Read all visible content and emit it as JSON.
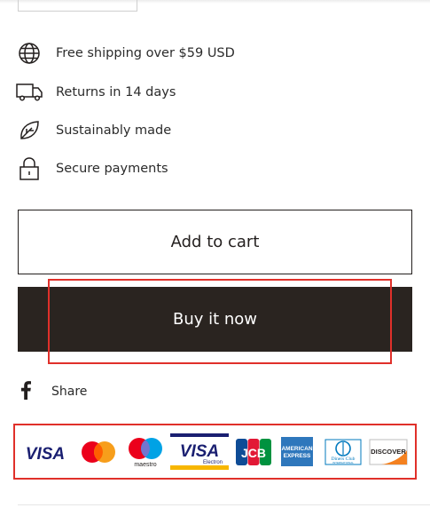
{
  "features": [
    {
      "icon": "globe-icon",
      "label": "Free shipping over $59 USD"
    },
    {
      "icon": "truck-icon",
      "label": "Returns in 14 days"
    },
    {
      "icon": "leaf-icon",
      "label": "Sustainably made"
    },
    {
      "icon": "lock-icon",
      "label": "Secure payments"
    }
  ],
  "buttons": {
    "add_to_cart": "Add to cart",
    "buy_now": "Buy it now"
  },
  "share": {
    "label": "Share",
    "icon": "facebook-icon"
  },
  "payment_icons": [
    "visa",
    "mastercard",
    "maestro",
    "visa-electron",
    "jcb",
    "american-express",
    "diners-club",
    "discover"
  ],
  "payment_text": {
    "visa": "VISA",
    "maestro": "maestro",
    "visa_electron": "VISA",
    "visa_electron_sub": "Electron",
    "jcb": "JCB",
    "amex_line1": "AMERICAN",
    "amex_line2": "EXPRESS",
    "diners_line1": "Diners Club",
    "diners_line2": "INTERNATIONAL",
    "discover": "DISCOVER"
  },
  "colors": {
    "text": "#231f1e",
    "buy_button_bg": "#2a2420",
    "highlight": "#e0302a",
    "visa_blue": "#1a1f71",
    "mastercard_red": "#eb001b",
    "mastercard_orange": "#f79e1b",
    "maestro_blue": "#00a2e5",
    "amex_blue": "#2e77bc",
    "discover_orange": "#f48120"
  }
}
